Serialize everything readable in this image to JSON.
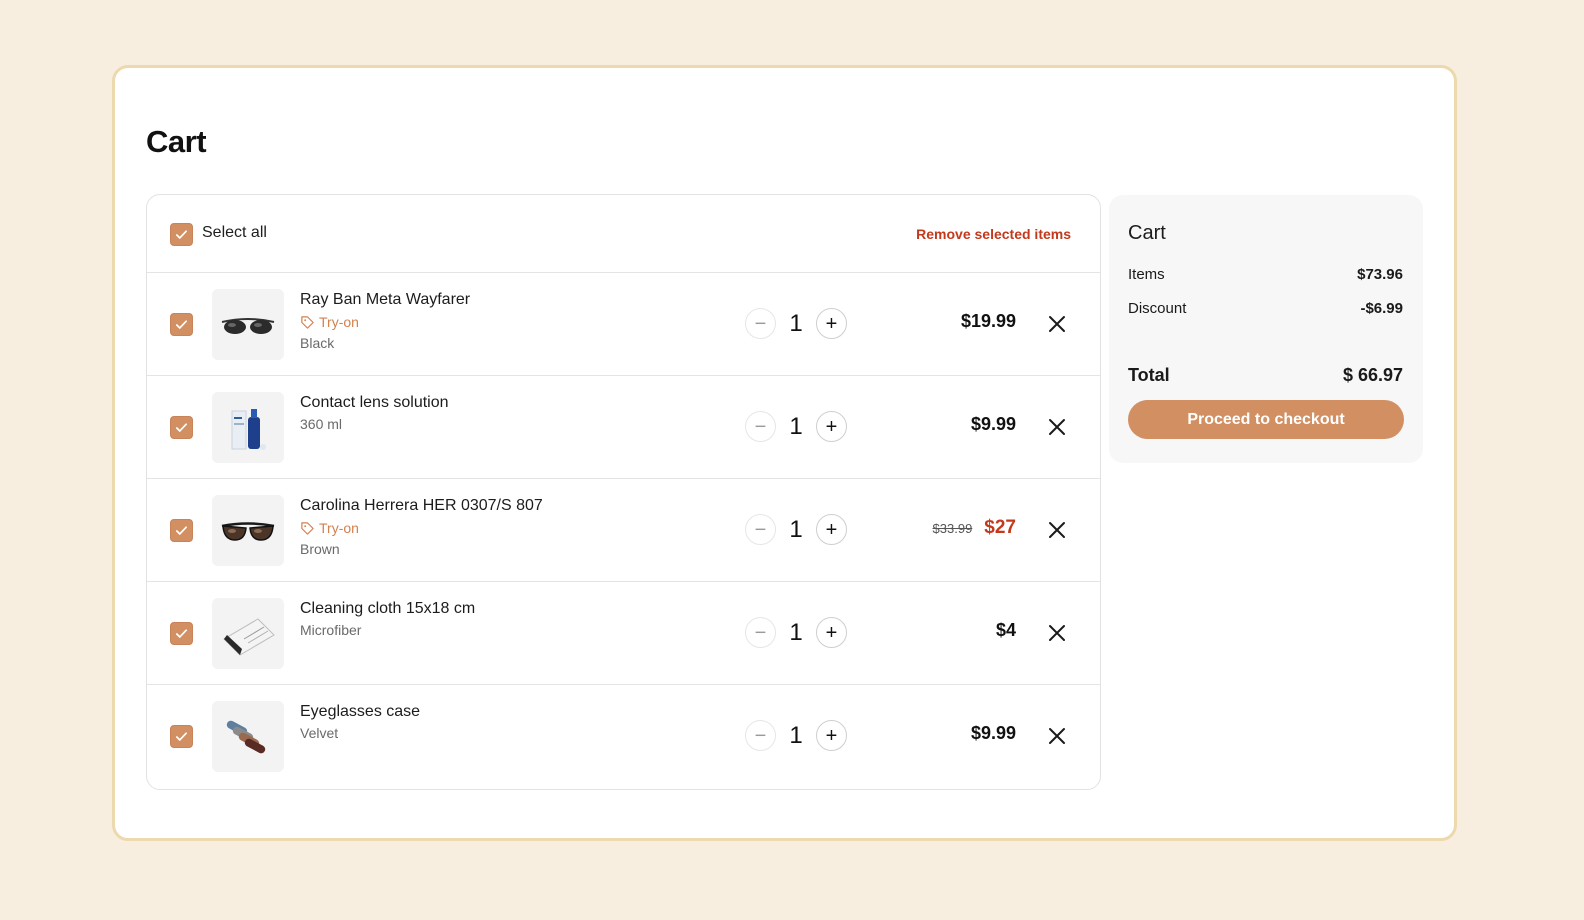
{
  "page": {
    "title": "Cart"
  },
  "list": {
    "select_all_label": "Select all",
    "remove_selected_label": "Remove selected items"
  },
  "items": [
    {
      "name": "Ray Ban Meta Wayfarer",
      "tag": "Try-on",
      "variant": "Black",
      "qty": "1",
      "price": "$19.99",
      "checked": true,
      "image": "sunglasses-black"
    },
    {
      "name": "Contact lens solution",
      "variant": "360 ml",
      "qty": "1",
      "price": "$9.99",
      "checked": true,
      "image": "lens-solution-bottle"
    },
    {
      "name": "Carolina Herrera HER 0307/S 807",
      "tag": "Try-on",
      "variant": "Brown",
      "qty": "1",
      "old_price": "$33.99",
      "price": "$27",
      "checked": true,
      "image": "sunglasses-brown"
    },
    {
      "name": "Cleaning cloth 15x18 cm",
      "variant": "Microfiber",
      "qty": "1",
      "price": "$4",
      "checked": true,
      "image": "cleaning-cloth"
    },
    {
      "name": "Eyeglasses case",
      "variant": "Velvet",
      "qty": "1",
      "price": "$9.99",
      "checked": true,
      "image": "velvet-cases"
    }
  ],
  "summary": {
    "title": "Cart",
    "items_label": "Items",
    "items_value": "$73.96",
    "discount_label": "Discount",
    "discount_value": "-$6.99",
    "total_label": "Total",
    "total_value": "$ 66.97",
    "checkout_label": "Proceed to checkout"
  },
  "colors": {
    "accent": "#d28f62",
    "sale": "#c2391c",
    "background": "#f8eedf",
    "frame_border": "#ecd9ad"
  }
}
